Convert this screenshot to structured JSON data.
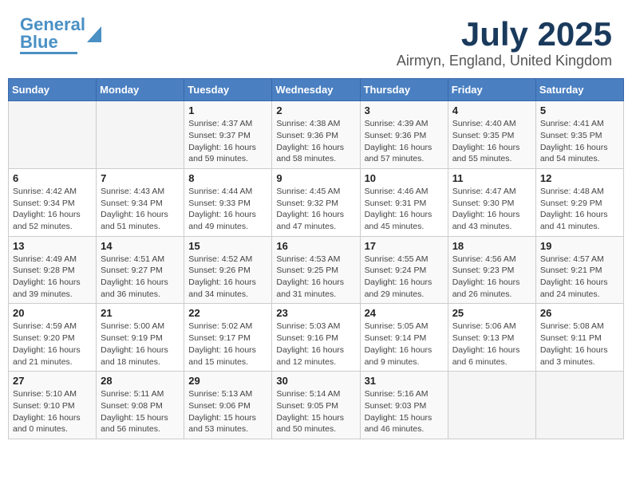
{
  "logo": {
    "text1": "General",
    "text2": "Blue"
  },
  "header": {
    "month_year": "July 2025",
    "location": "Airmyn, England, United Kingdom"
  },
  "weekdays": [
    "Sunday",
    "Monday",
    "Tuesday",
    "Wednesday",
    "Thursday",
    "Friday",
    "Saturday"
  ],
  "weeks": [
    [
      {
        "day": "",
        "info": ""
      },
      {
        "day": "",
        "info": ""
      },
      {
        "day": "1",
        "info": "Sunrise: 4:37 AM\nSunset: 9:37 PM\nDaylight: 16 hours\nand 59 minutes."
      },
      {
        "day": "2",
        "info": "Sunrise: 4:38 AM\nSunset: 9:36 PM\nDaylight: 16 hours\nand 58 minutes."
      },
      {
        "day": "3",
        "info": "Sunrise: 4:39 AM\nSunset: 9:36 PM\nDaylight: 16 hours\nand 57 minutes."
      },
      {
        "day": "4",
        "info": "Sunrise: 4:40 AM\nSunset: 9:35 PM\nDaylight: 16 hours\nand 55 minutes."
      },
      {
        "day": "5",
        "info": "Sunrise: 4:41 AM\nSunset: 9:35 PM\nDaylight: 16 hours\nand 54 minutes."
      }
    ],
    [
      {
        "day": "6",
        "info": "Sunrise: 4:42 AM\nSunset: 9:34 PM\nDaylight: 16 hours\nand 52 minutes."
      },
      {
        "day": "7",
        "info": "Sunrise: 4:43 AM\nSunset: 9:34 PM\nDaylight: 16 hours\nand 51 minutes."
      },
      {
        "day": "8",
        "info": "Sunrise: 4:44 AM\nSunset: 9:33 PM\nDaylight: 16 hours\nand 49 minutes."
      },
      {
        "day": "9",
        "info": "Sunrise: 4:45 AM\nSunset: 9:32 PM\nDaylight: 16 hours\nand 47 minutes."
      },
      {
        "day": "10",
        "info": "Sunrise: 4:46 AM\nSunset: 9:31 PM\nDaylight: 16 hours\nand 45 minutes."
      },
      {
        "day": "11",
        "info": "Sunrise: 4:47 AM\nSunset: 9:30 PM\nDaylight: 16 hours\nand 43 minutes."
      },
      {
        "day": "12",
        "info": "Sunrise: 4:48 AM\nSunset: 9:29 PM\nDaylight: 16 hours\nand 41 minutes."
      }
    ],
    [
      {
        "day": "13",
        "info": "Sunrise: 4:49 AM\nSunset: 9:28 PM\nDaylight: 16 hours\nand 39 minutes."
      },
      {
        "day": "14",
        "info": "Sunrise: 4:51 AM\nSunset: 9:27 PM\nDaylight: 16 hours\nand 36 minutes."
      },
      {
        "day": "15",
        "info": "Sunrise: 4:52 AM\nSunset: 9:26 PM\nDaylight: 16 hours\nand 34 minutes."
      },
      {
        "day": "16",
        "info": "Sunrise: 4:53 AM\nSunset: 9:25 PM\nDaylight: 16 hours\nand 31 minutes."
      },
      {
        "day": "17",
        "info": "Sunrise: 4:55 AM\nSunset: 9:24 PM\nDaylight: 16 hours\nand 29 minutes."
      },
      {
        "day": "18",
        "info": "Sunrise: 4:56 AM\nSunset: 9:23 PM\nDaylight: 16 hours\nand 26 minutes."
      },
      {
        "day": "19",
        "info": "Sunrise: 4:57 AM\nSunset: 9:21 PM\nDaylight: 16 hours\nand 24 minutes."
      }
    ],
    [
      {
        "day": "20",
        "info": "Sunrise: 4:59 AM\nSunset: 9:20 PM\nDaylight: 16 hours\nand 21 minutes."
      },
      {
        "day": "21",
        "info": "Sunrise: 5:00 AM\nSunset: 9:19 PM\nDaylight: 16 hours\nand 18 minutes."
      },
      {
        "day": "22",
        "info": "Sunrise: 5:02 AM\nSunset: 9:17 PM\nDaylight: 16 hours\nand 15 minutes."
      },
      {
        "day": "23",
        "info": "Sunrise: 5:03 AM\nSunset: 9:16 PM\nDaylight: 16 hours\nand 12 minutes."
      },
      {
        "day": "24",
        "info": "Sunrise: 5:05 AM\nSunset: 9:14 PM\nDaylight: 16 hours\nand 9 minutes."
      },
      {
        "day": "25",
        "info": "Sunrise: 5:06 AM\nSunset: 9:13 PM\nDaylight: 16 hours\nand 6 minutes."
      },
      {
        "day": "26",
        "info": "Sunrise: 5:08 AM\nSunset: 9:11 PM\nDaylight: 16 hours\nand 3 minutes."
      }
    ],
    [
      {
        "day": "27",
        "info": "Sunrise: 5:10 AM\nSunset: 9:10 PM\nDaylight: 16 hours\nand 0 minutes."
      },
      {
        "day": "28",
        "info": "Sunrise: 5:11 AM\nSunset: 9:08 PM\nDaylight: 15 hours\nand 56 minutes."
      },
      {
        "day": "29",
        "info": "Sunrise: 5:13 AM\nSunset: 9:06 PM\nDaylight: 15 hours\nand 53 minutes."
      },
      {
        "day": "30",
        "info": "Sunrise: 5:14 AM\nSunset: 9:05 PM\nDaylight: 15 hours\nand 50 minutes."
      },
      {
        "day": "31",
        "info": "Sunrise: 5:16 AM\nSunset: 9:03 PM\nDaylight: 15 hours\nand 46 minutes."
      },
      {
        "day": "",
        "info": ""
      },
      {
        "day": "",
        "info": ""
      }
    ]
  ]
}
